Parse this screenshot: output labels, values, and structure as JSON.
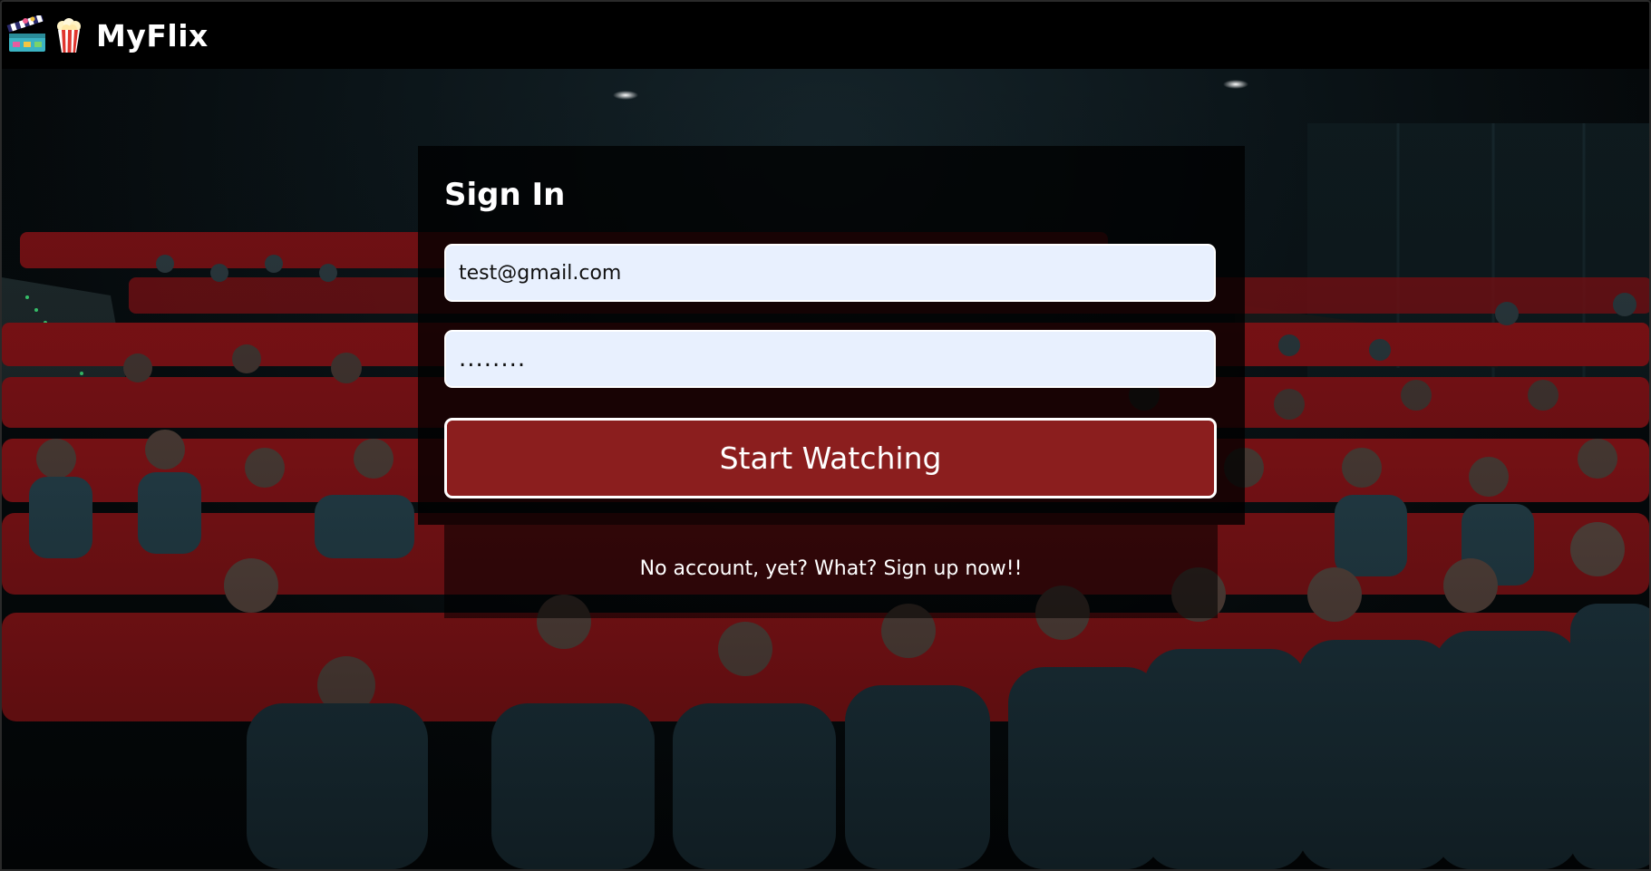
{
  "app": {
    "brand_name": "MyFlix",
    "logo_icons": [
      "clapperboard-icon",
      "popcorn-icon"
    ]
  },
  "signin": {
    "title": "Sign In",
    "email_value": "test@gmail.com",
    "password_value": "........",
    "submit_label": "Start Watching",
    "signup_text": "No account, yet? What? Sign up now!!"
  },
  "colors": {
    "header_bg": "#000000",
    "button_bg": "#8b1e1e",
    "input_bg": "#e8f0fe",
    "seat_red": "#9b1418"
  }
}
